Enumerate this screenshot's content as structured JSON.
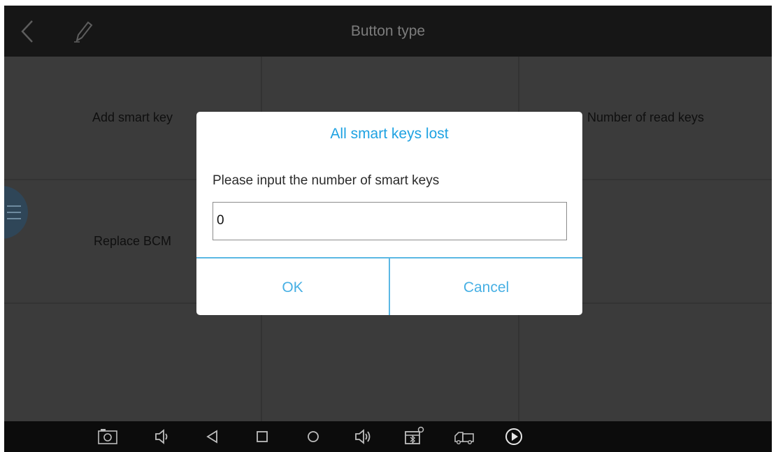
{
  "header": {
    "title": "Button type",
    "back_icon": "back-chevron-icon",
    "edit_icon": "pencil-icon"
  },
  "grid": {
    "cells": [
      {
        "label": "Add smart key"
      },
      {
        "label": ""
      },
      {
        "label": "Number of read keys"
      },
      {
        "label": "Replace BCM"
      },
      {
        "label": ""
      },
      {
        "label": ""
      },
      {
        "label": ""
      },
      {
        "label": ""
      },
      {
        "label": ""
      }
    ]
  },
  "dialog": {
    "title": "All smart keys lost",
    "prompt": "Please input the number of smart keys",
    "input_value": "0",
    "ok_label": "OK",
    "cancel_label": "Cancel"
  },
  "navbar": {
    "icons": [
      "screenshot-icon",
      "volume-down-icon",
      "back-triangle-icon",
      "recent-apps-icon",
      "home-circle-icon",
      "volume-up-icon",
      "vci-connection-icon",
      "truck-icon",
      "play-icon"
    ]
  },
  "colors": {
    "accent": "#1ea2e2",
    "divider": "#5bb8e4",
    "background": "#3a3a3a",
    "topbar": "#161616",
    "navbar": "#0c0c0c"
  }
}
